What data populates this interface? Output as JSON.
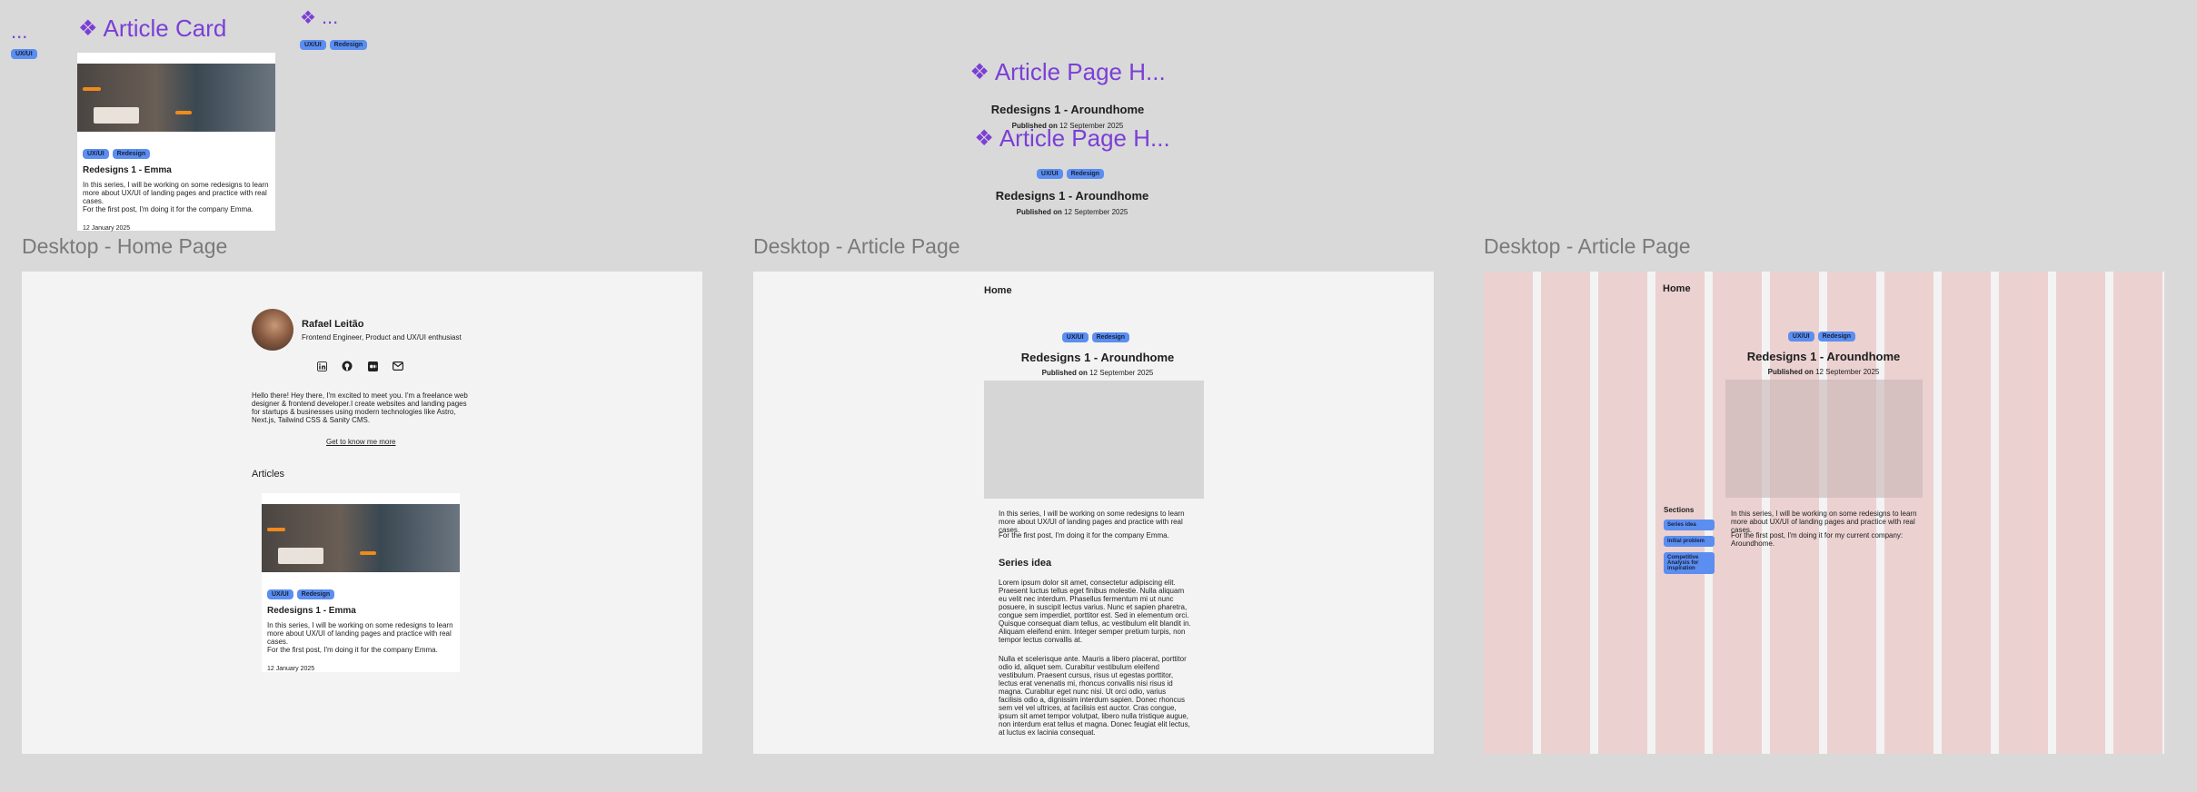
{
  "components": {
    "partial_left": {
      "title": "...",
      "tag": "UX/UI"
    },
    "article_card": {
      "title": "Article Card"
    },
    "partial_right": {
      "title": "...",
      "tags": [
        "UX/UI",
        "Redesign"
      ]
    },
    "article_page_header_1": {
      "title": "Article Page H...",
      "heading": "Redesigns 1 - Aroundhome",
      "published_label": "Published on",
      "published_date": "12 September 2025"
    },
    "article_page_header_2": {
      "title": "Article Page H...",
      "tags": [
        "UX/UI",
        "Redesign"
      ],
      "heading": "Redesigns 1 - Aroundhome",
      "published_label": "Published on",
      "published_date": "12 September 2025"
    }
  },
  "card": {
    "tags": [
      "UX/UI",
      "Redesign"
    ],
    "title": "Redesigns 1 - Emma",
    "body_line1": "In this series, I will be working on some redesigns to learn more about UX/UI of landing pages and practice with real cases.",
    "body_line2": "For the first post, I'm doing it for the company Emma.",
    "date": "12 January 2025"
  },
  "frames": {
    "home": {
      "label": "Desktop - Home Page",
      "name": "Rafael Leitão",
      "role": "Frontend Engineer, Product and UX/UI enthusiast",
      "bio": "Hello there! Hey there, I'm excited to meet you. I'm a freelance web designer & frontend developer.I create websites and landing pages for startups & businesses using modern technologies like Astro, Next.js, Tailwind CSS & Sanity CMS.",
      "know_more": "Get to know me more",
      "articles_heading": "Articles",
      "social_icons": [
        "linkedin-icon",
        "github-icon",
        "medium-icon",
        "mail-icon"
      ]
    },
    "article": {
      "label": "Desktop - Article Page",
      "nav_home": "Home",
      "tags": [
        "UX/UI",
        "Redesign"
      ],
      "heading": "Redesigns 1 - Aroundhome",
      "published_label": "Published on",
      "published_date": "12 September 2025",
      "intro1": "In this series, I will be working on some redesigns to learn more about UX/UI of landing pages and practice with real cases.",
      "intro2": "For the first post, I'm doing it for the company Emma.",
      "section_heading": "Series idea",
      "para1": "Lorem ipsum dolor sit amet, consectetur adipiscing elit. Praesent luctus tellus eget finibus molestie. Nulla aliquam eu velit nec interdum. Phasellus fermentum mi ut nunc posuere, in suscipit lectus varius. Nunc et sapien pharetra, congue sem imperdiet, porttitor est. Sed in elementum orci. Quisque consequat diam tellus, ac vestibulum elit blandit in. Aliquam eleifend enim. Integer semper pretium turpis, non tempor lectus convallis at.",
      "para2": "Nulla et scelerisque ante. Mauris a libero placerat, porttitor odio id, aliquet sem. Curabitur vestibulum eleifend vestibulum. Praesent cursus, risus ut egestas porttitor, lectus erat venenatis mi, rhoncus convallis nisi risus id magna. Curabitur eget nunc nisi. Ut orci odio, varius facilisis odio a, dignissim interdum sapien. Donec rhoncus sem vel vel ultrices, at facilisis est auctor. Cras congue, ipsum sit amet tempor volutpat, libero nulla tristique augue, non interdum erat tellus et magna. Donec feugiat elit lectus, at luctus ex lacinia consequat."
    },
    "article_grid": {
      "label": "Desktop - Article Page",
      "nav_home": "Home",
      "tags": [
        "UX/UI",
        "Redesign"
      ],
      "heading": "Redesigns 1 - Aroundhome",
      "published_label": "Published on",
      "published_date": "12 September 2025",
      "sections_label": "Sections",
      "section_links": [
        "Series idea",
        "Initial problem",
        "Competitive Analysis for inspiration"
      ],
      "intro1": "In this series, I will be working on some redesigns to learn more about UX/UI of landing pages and practice with real cases.",
      "intro2": "For the first post, I'm doing it for my current company: Aroundhome."
    }
  },
  "colors": {
    "component_purple": "#7b3fd6",
    "tag_blue": "#5b8ef0",
    "canvas": "#d9d9d9",
    "grid_column": "#e6b4b4"
  }
}
